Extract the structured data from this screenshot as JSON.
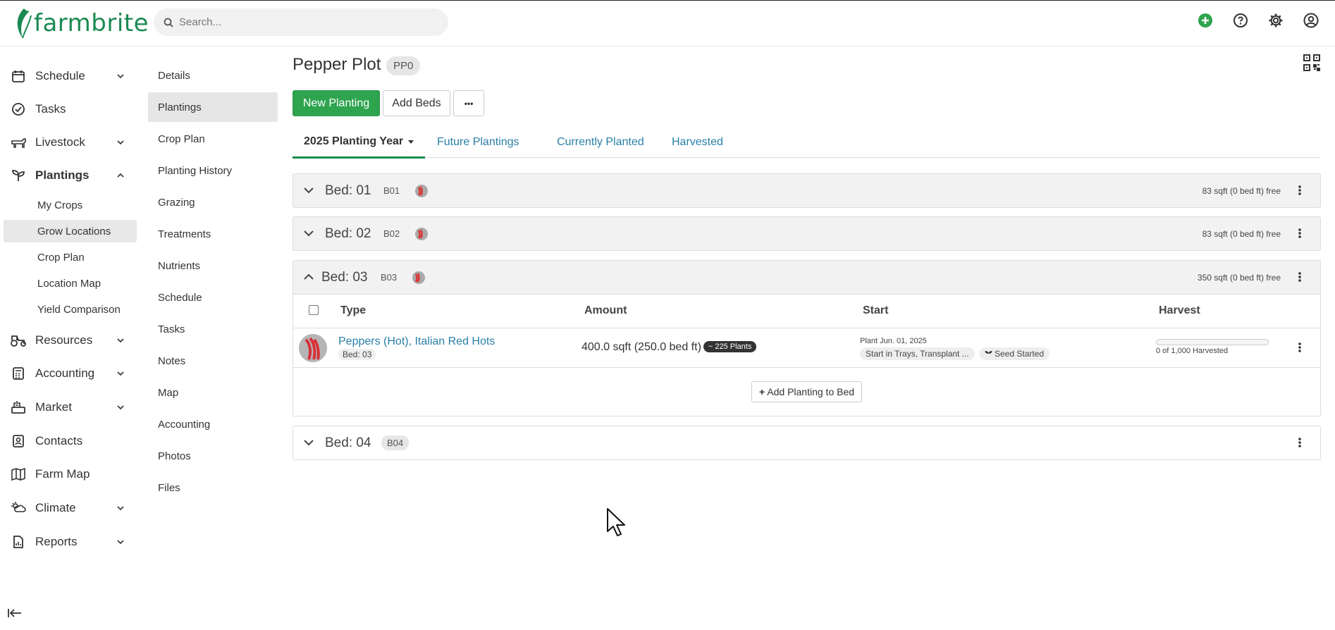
{
  "app": {
    "logo_text": "farmbrite",
    "brand_color": "#1b8a52"
  },
  "search": {
    "placeholder": "Search..."
  },
  "top_icons": [
    "add-circle-icon",
    "help-icon",
    "gear-icon",
    "user-account-icon"
  ],
  "leftnav": {
    "items": [
      {
        "label": "Schedule",
        "icon": "calendar-icon",
        "expandable": true
      },
      {
        "label": "Tasks",
        "icon": "check-circle-icon",
        "expandable": false
      },
      {
        "label": "Livestock",
        "icon": "livestock-icon",
        "expandable": true
      },
      {
        "label": "Plantings",
        "icon": "sprout-icon",
        "expandable": true,
        "expanded": true
      },
      {
        "label": "Resources",
        "icon": "tractor-icon",
        "expandable": true
      },
      {
        "label": "Accounting",
        "icon": "calculator-icon",
        "expandable": true
      },
      {
        "label": "Market",
        "icon": "register-icon",
        "expandable": true
      },
      {
        "label": "Contacts",
        "icon": "contacts-icon",
        "expandable": false
      },
      {
        "label": "Farm Map",
        "icon": "map-icon",
        "expandable": false
      },
      {
        "label": "Climate",
        "icon": "weather-icon",
        "expandable": true
      },
      {
        "label": "Reports",
        "icon": "report-icon",
        "expandable": true
      }
    ],
    "plantings_sub": [
      "My Crops",
      "Grow Locations",
      "Crop Plan",
      "Location Map",
      "Yield Comparison"
    ],
    "selected_sub": "Grow Locations"
  },
  "secnav": {
    "items": [
      "Details",
      "Plantings",
      "Crop Plan",
      "Planting History",
      "Grazing",
      "Treatments",
      "Nutrients",
      "Schedule",
      "Tasks",
      "Notes",
      "Map",
      "Accounting",
      "Photos",
      "Files"
    ],
    "selected": "Plantings"
  },
  "page": {
    "title": "Pepper Plot",
    "code": "PP0"
  },
  "toolbar": {
    "new_planting": "New Planting",
    "add_beds": "Add Beds",
    "more": "•••"
  },
  "tabs": [
    "2025 Planting Year",
    "Future Plantings",
    "Currently Planted",
    "Harvested"
  ],
  "beds": [
    {
      "name": "Bed: 01",
      "code": "B01",
      "free": "83 sqft (0 bed ft) free"
    },
    {
      "name": "Bed: 02",
      "code": "B02",
      "free": "83 sqft (0 bed ft) free"
    },
    {
      "name": "Bed: 03",
      "code": "B03",
      "free": "350 sqft (0 bed ft) free"
    },
    {
      "name": "Bed: 04",
      "code": "B04",
      "free": ""
    }
  ],
  "table": {
    "headers": {
      "type": "Type",
      "amount": "Amount",
      "start": "Start",
      "harvest": "Harvest"
    },
    "row": {
      "crop": "Peppers (Hot), Italian Red Hots",
      "bed": "Bed: 03",
      "amount": "400.0 sqft (250.0 bed ft)",
      "plants": "~ 225 Plants",
      "start_date": "Plant Jun. 01, 2025",
      "method": "Start in Trays, Transplant ...",
      "status": "Seed Started",
      "harvest_fraction": 0,
      "harvest_text": "0 of 1,000 Harvested"
    },
    "add_planting": "Add Planting to Bed"
  }
}
